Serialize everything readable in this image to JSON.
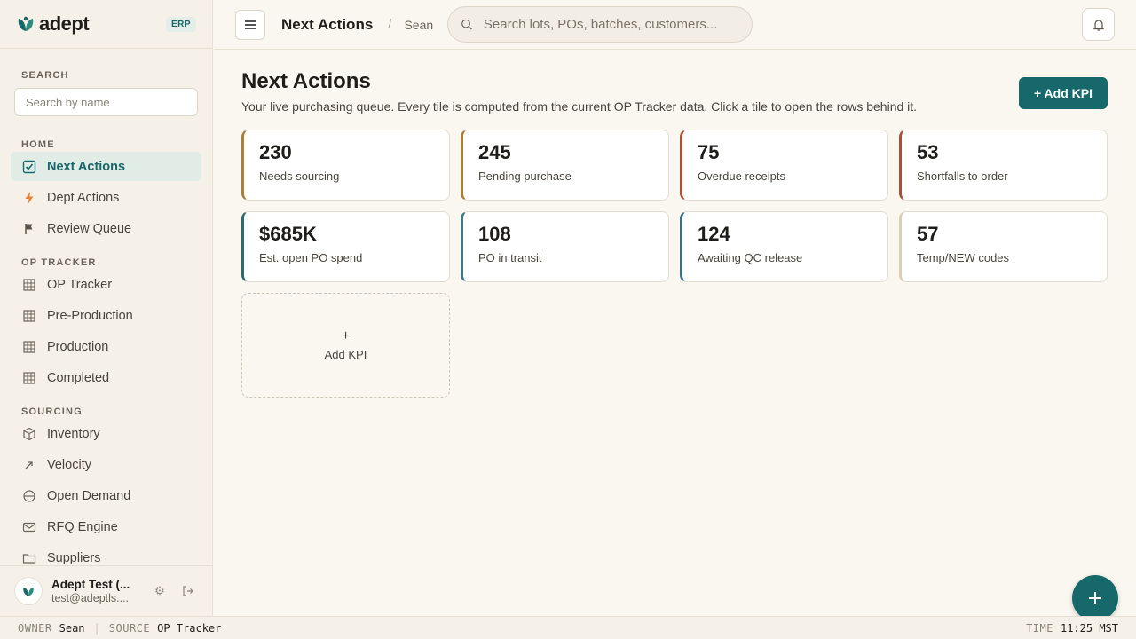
{
  "brand": {
    "name": "adept",
    "badge": "ERP"
  },
  "sidebar": {
    "search_label": "SEARCH",
    "search_placeholder": "Search by name",
    "sections": [
      {
        "label": "HOME",
        "items": [
          {
            "label": "Next Actions",
            "icon": "check-square-icon",
            "active": true
          },
          {
            "label": "Dept Actions",
            "icon": "lightning-icon"
          },
          {
            "label": "Review Queue",
            "icon": "flag-icon"
          }
        ]
      },
      {
        "label": "OP TRACKER",
        "items": [
          {
            "label": "OP Tracker",
            "icon": "grid-icon"
          },
          {
            "label": "Pre-Production",
            "icon": "grid-icon"
          },
          {
            "label": "Production",
            "icon": "grid-icon"
          },
          {
            "label": "Completed",
            "icon": "grid-icon"
          }
        ]
      },
      {
        "label": "SOURCING",
        "items": [
          {
            "label": "Inventory",
            "icon": "box-icon"
          },
          {
            "label": "Velocity",
            "icon": "trend-icon"
          },
          {
            "label": "Open Demand",
            "icon": "circle-minus-icon"
          },
          {
            "label": "RFQ Engine",
            "icon": "mail-icon"
          },
          {
            "label": "Suppliers",
            "icon": "folder-icon"
          }
        ]
      }
    ],
    "user": {
      "name": "Adept Test (...",
      "email": "test@adeptls...."
    }
  },
  "header": {
    "title": "Next Actions",
    "user": "Sean",
    "search_placeholder": "Search lots, POs, batches, customers..."
  },
  "main": {
    "title": "Next Actions",
    "subtitle": "Your live purchasing queue. Every tile is computed from the current OP Tracker data. Click a tile to open the rows behind it.",
    "add_kpi_label": "+ Add KPI",
    "tiles": [
      {
        "value": "230",
        "label": "Needs sourcing",
        "color": "#a8803a"
      },
      {
        "value": "245",
        "label": "Pending purchase",
        "color": "#b07a3c"
      },
      {
        "value": "75",
        "label": "Overdue receipts",
        "color": "#a8503e"
      },
      {
        "value": "53",
        "label": "Shortfalls to order",
        "color": "#a8503e"
      },
      {
        "value": "$685K",
        "label": "Est. open PO spend",
        "color": "#2f6a6e"
      },
      {
        "value": "108",
        "label": "PO in transit",
        "color": "#3f7585"
      },
      {
        "value": "124",
        "label": "Awaiting QC release",
        "color": "#3f6f80"
      },
      {
        "value": "57",
        "label": "Temp/NEW codes",
        "color": "#d9cdb6"
      }
    ],
    "add_tile": {
      "plus": "+",
      "label": "Add KPI"
    }
  },
  "statusbar": {
    "owner_key": "OWNER",
    "owner_val": "Sean",
    "source_key": "SOURCE",
    "source_val": "OP Tracker",
    "time_key": "TIME",
    "time_val": "11:25 MST"
  }
}
